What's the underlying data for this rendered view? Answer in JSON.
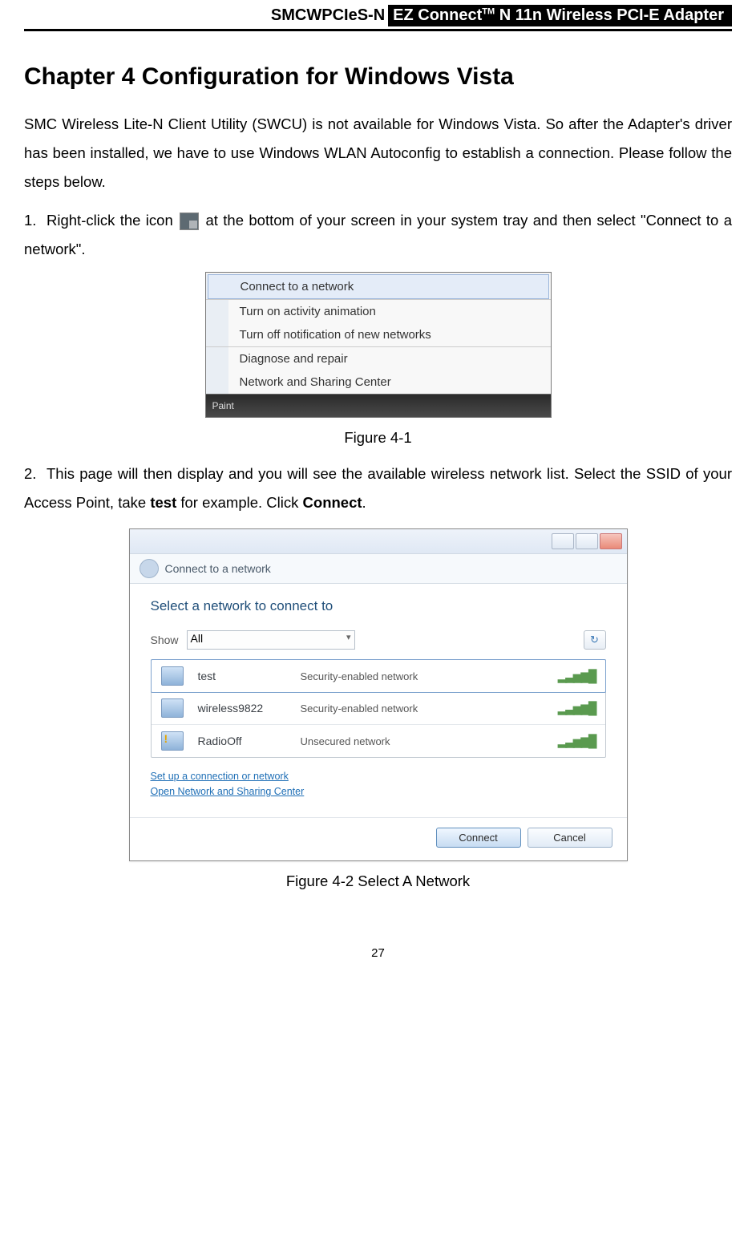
{
  "header": {
    "left": "SMCWPCIeS-N",
    "right_prefix": "EZ Connect",
    "right_tm": "TM",
    "right_suffix": " N 11n Wireless PCI-E Adapter"
  },
  "chapter": {
    "title": "Chapter 4    Configuration for Windows Vista",
    "intro": "SMC Wireless Lite-N Client Utility (SWCU) is not available for Windows Vista. So after the Adapter's driver has been installed, we have to use Windows WLAN Autoconfig to establish a connection. Please follow the steps below."
  },
  "steps": [
    {
      "num": "1.",
      "pre": "Right-click the icon ",
      "post": " at the bottom of your screen in your system tray and then select \"Connect to a network\"."
    },
    {
      "num": "2.",
      "text_parts": [
        "This page will then display and you will see the available wireless network list. Select the SSID of your Access Point, take ",
        "test",
        " for example. Click ",
        "Connect",
        "."
      ]
    }
  ],
  "figure41": {
    "caption": "Figure 4-1",
    "menu": {
      "items": [
        "Connect to a network",
        "Turn on activity animation",
        "Turn off notification of new networks",
        "Diagnose and repair",
        "Network and Sharing Center"
      ],
      "taskbar_hint": "Paint"
    }
  },
  "figure42": {
    "caption": "Figure 4-2 Select A Network",
    "breadcrumb": "Connect to a network",
    "heading": "Select a network to connect to",
    "show_label": "Show",
    "show_value": "All",
    "networks": [
      {
        "ssid": "test",
        "security": "Security-enabled network",
        "selected": true,
        "warn": false
      },
      {
        "ssid": "wireless9822",
        "security": "Security-enabled network",
        "selected": false,
        "warn": false
      },
      {
        "ssid": "RadioOff",
        "security": "Unsecured network",
        "selected": false,
        "warn": true
      }
    ],
    "links": [
      "Set up a connection or network",
      "Open Network and Sharing Center"
    ],
    "buttons": {
      "connect": "Connect",
      "cancel": "Cancel"
    }
  },
  "page_number": "27"
}
